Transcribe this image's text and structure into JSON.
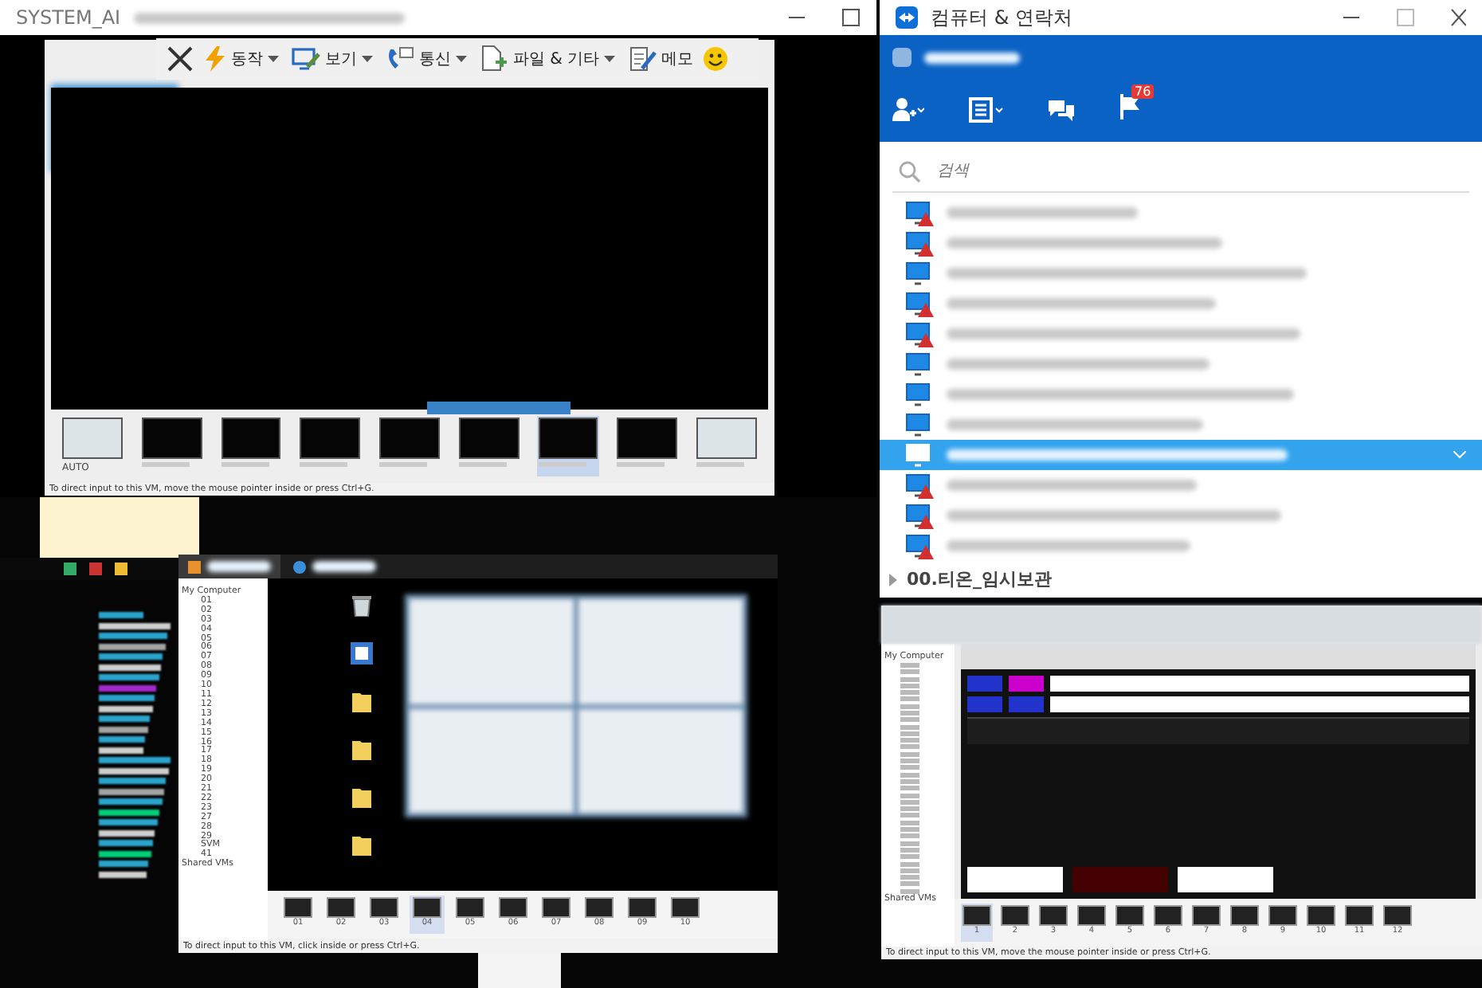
{
  "remote_window": {
    "title": "SYSTEM_AI",
    "toolbar": [
      {
        "kind": "close"
      },
      {
        "kind": "actions",
        "label": "동작",
        "dropdown": true
      },
      {
        "kind": "view",
        "label": "보기",
        "dropdown": true
      },
      {
        "kind": "communicate",
        "label": "통신",
        "dropdown": true
      },
      {
        "kind": "files",
        "label": "파일 & 기타",
        "dropdown": true
      },
      {
        "kind": "memo",
        "label": "메모",
        "dropdown": false
      },
      {
        "kind": "feedback"
      }
    ],
    "vm": {
      "thumbnails": [
        {
          "label": "AUTO",
          "selected": false
        },
        {
          "selected": false
        },
        {
          "selected": false
        },
        {
          "selected": false
        },
        {
          "selected": false
        },
        {
          "selected": false
        },
        {
          "selected": true
        },
        {
          "selected": false
        },
        {
          "selected": false
        }
      ],
      "status": "To direct input to this VM, move the mouse pointer inside or press Ctrl+G."
    }
  },
  "contacts_window": {
    "title": "컴퓨터 & 연락처",
    "notification_badge": "76",
    "search": {
      "placeholder": "검색"
    },
    "computers": [
      {
        "warning": true,
        "selected": false
      },
      {
        "warning": true,
        "selected": false
      },
      {
        "warning": false,
        "selected": false
      },
      {
        "warning": true,
        "selected": false
      },
      {
        "warning": true,
        "selected": false
      },
      {
        "warning": false,
        "selected": false
      },
      {
        "warning": false,
        "selected": false
      },
      {
        "warning": false,
        "selected": false
      },
      {
        "warning": false,
        "selected": true
      },
      {
        "warning": true,
        "selected": false
      },
      {
        "warning": true,
        "selected": false
      },
      {
        "warning": true,
        "selected": false
      }
    ],
    "group": {
      "label": "00.티온_임시보관",
      "expanded": false
    }
  },
  "vm_left": {
    "tabs": [
      {
        "selected": true
      },
      {
        "selected": false
      }
    ],
    "tree": {
      "root": "My Computer",
      "children": [
        "01",
        "02",
        "03",
        "04",
        "05",
        "06",
        "07",
        "08",
        "09",
        "10",
        "11",
        "12",
        "13",
        "14",
        "15",
        "16",
        "17",
        "18",
        "19",
        "20",
        "21",
        "22",
        "23",
        "27",
        "28",
        "29",
        "SVM",
        "41"
      ],
      "shared": "Shared VMs"
    },
    "thumbnails": [
      {
        "label": "01",
        "selected": false
      },
      {
        "label": "02",
        "selected": false
      },
      {
        "label": "03",
        "selected": false
      },
      {
        "label": "04",
        "selected": true
      },
      {
        "label": "05",
        "selected": false
      },
      {
        "label": "06",
        "selected": false
      },
      {
        "label": "07",
        "selected": false
      },
      {
        "label": "08",
        "selected": false
      },
      {
        "label": "09",
        "selected": false
      },
      {
        "label": "10",
        "selected": false
      }
    ],
    "status": "To direct input to this VM, click inside or press Ctrl+G."
  },
  "vm_right": {
    "tree": {
      "root": "My Computer",
      "shared": "Shared VMs"
    },
    "thumbnails": [
      {
        "label": "1",
        "selected": true
      },
      {
        "label": "2",
        "selected": false
      },
      {
        "label": "3",
        "selected": false
      },
      {
        "label": "4",
        "selected": false
      },
      {
        "label": "5",
        "selected": false
      },
      {
        "label": "6",
        "selected": false
      },
      {
        "label": "7",
        "selected": false
      },
      {
        "label": "8",
        "selected": false
      },
      {
        "label": "9",
        "selected": false
      },
      {
        "label": "10",
        "selected": false
      },
      {
        "label": "11",
        "selected": false
      },
      {
        "label": "12",
        "selected": false
      }
    ],
    "status": "To direct input to this VM, move the mouse pointer inside or press Ctrl+G."
  }
}
